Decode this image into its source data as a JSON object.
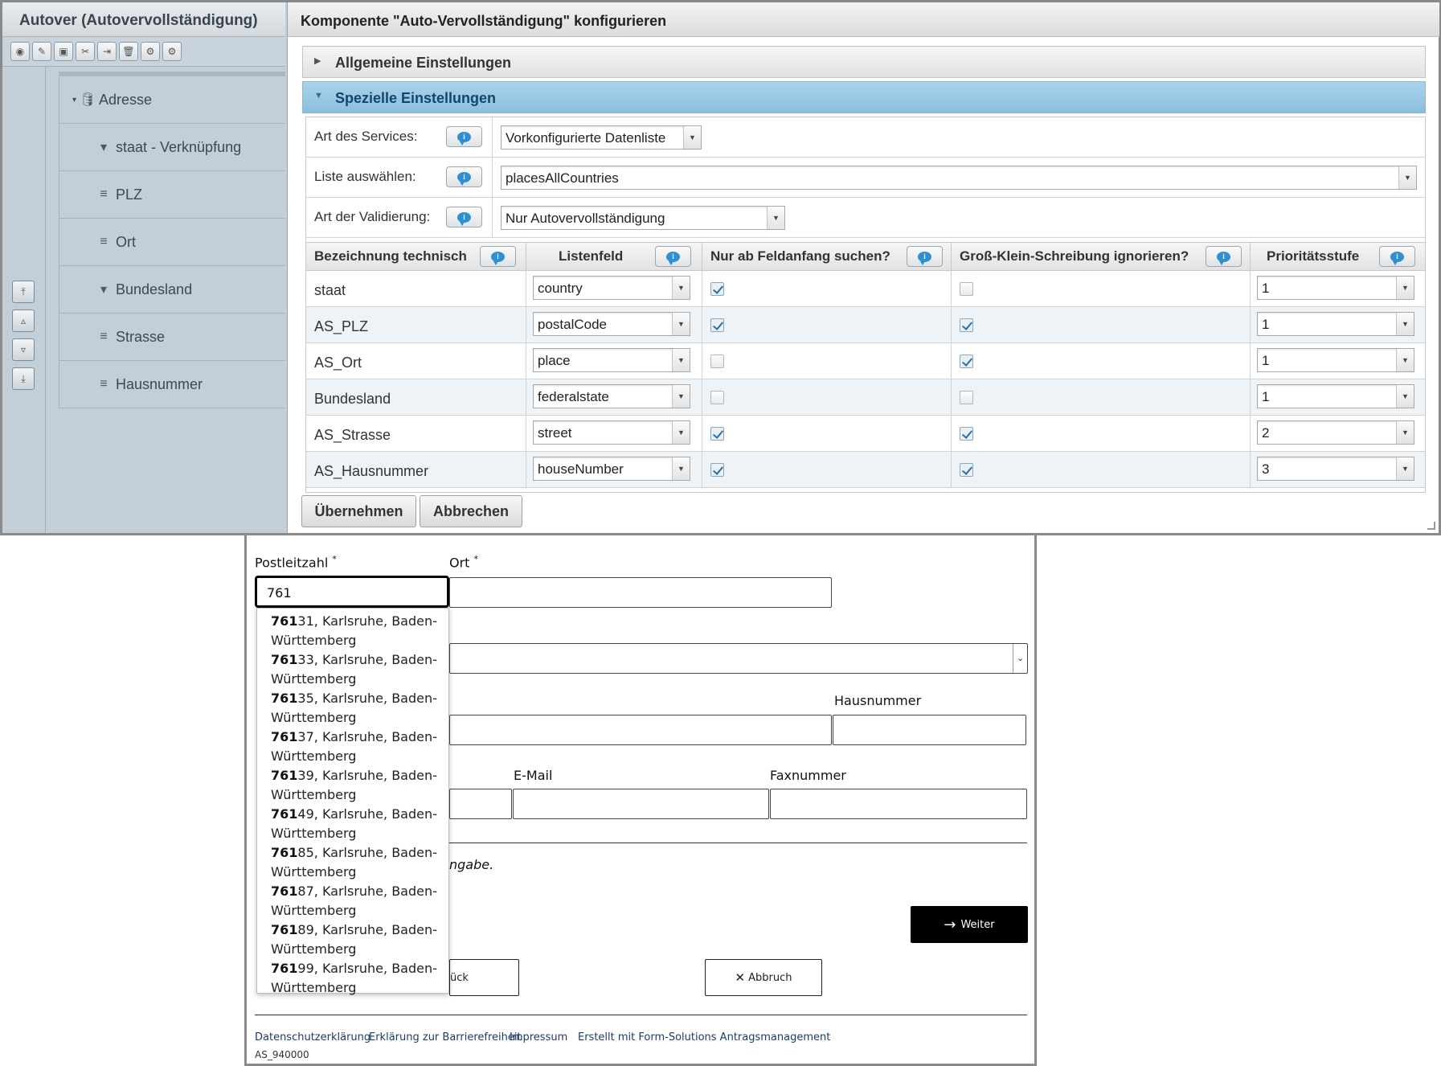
{
  "left_panel": {
    "title": "Autover (Autovervollständigung)",
    "toolbar_icons": [
      "eye-icon",
      "edit-icon",
      "save-icon",
      "pin-icon",
      "export-icon",
      "trash-icon",
      "cogs-icon",
      "gear-icon"
    ],
    "tree": [
      {
        "icon": "database-icon",
        "label": "Adresse",
        "expanded": true
      },
      {
        "icon": "dropdown-field-icon",
        "label": "staat - Verknüpfung"
      },
      {
        "icon": "text-field-icon",
        "label": "PLZ"
      },
      {
        "icon": "text-field-icon",
        "label": "Ort"
      },
      {
        "icon": "dropdown-field-icon",
        "label": "Bundesland"
      },
      {
        "icon": "text-field-icon",
        "label": "Strasse"
      },
      {
        "icon": "text-field-icon",
        "label": "Hausnummer"
      }
    ]
  },
  "dialog": {
    "title": "Komponente \"Auto-Vervollständigung\" konfigurieren",
    "sections": {
      "general": "Allgemeine Einstellungen",
      "special": "Spezielle Einstellungen"
    },
    "service_label": "Art des Services:",
    "service_value": "Vorkonfigurierte Datenliste",
    "list_label": "Liste auswählen:",
    "list_value": "placesAllCountries",
    "validation_label": "Art der Validierung:",
    "validation_value": "Nur Autovervollständigung",
    "columns": {
      "technical": "Bezeichnung technisch",
      "listfield": "Listenfeld",
      "prefix": "Nur ab Feldanfang suchen?",
      "case": "Groß-Klein-Schreibung ignorieren?",
      "priority": "Prioritätsstufe"
    },
    "rows": [
      {
        "name": "staat",
        "field": "country",
        "prefix_only": true,
        "ignore_case": false,
        "priority": "1"
      },
      {
        "name": "AS_PLZ",
        "field": "postalCode",
        "prefix_only": true,
        "ignore_case": true,
        "priority": "1"
      },
      {
        "name": "AS_Ort",
        "field": "place",
        "prefix_only": false,
        "ignore_case": true,
        "priority": "1"
      },
      {
        "name": "Bundesland",
        "field": "federalstate",
        "prefix_only": false,
        "ignore_case": false,
        "priority": "1"
      },
      {
        "name": "AS_Strasse",
        "field": "street",
        "prefix_only": true,
        "ignore_case": true,
        "priority": "2"
      },
      {
        "name": "AS_Hausnummer",
        "field": "houseNumber",
        "prefix_only": true,
        "ignore_case": true,
        "priority": "3"
      }
    ],
    "apply_label": "Übernehmen",
    "cancel_label": "Abbrechen"
  },
  "webform": {
    "plz_label": "Postleitzahl",
    "plz_value": "761",
    "ort_label": "Ort",
    "required_mark": "*",
    "hausnummer_label": "Hausnummer",
    "email_label": "E-Mail",
    "fax_label": "Faxnummer",
    "partial_text": "ngabe.",
    "suggestion_rest": ", Karlsruhe, Baden-Württemberg",
    "suggestions": [
      {
        "match": "761",
        "rest": "31"
      },
      {
        "match": "761",
        "rest": "33"
      },
      {
        "match": "761",
        "rest": "35"
      },
      {
        "match": "761",
        "rest": "37"
      },
      {
        "match": "761",
        "rest": "39"
      },
      {
        "match": "761",
        "rest": "49"
      },
      {
        "match": "761",
        "rest": "85"
      },
      {
        "match": "761",
        "rest": "87"
      },
      {
        "match": "761",
        "rest": "89"
      },
      {
        "match": "761",
        "rest": "99"
      }
    ],
    "weiter_label": "Weiter",
    "back_partial_label": "ück",
    "abbruch_label": "Abbruch",
    "footer_links": [
      "Datenschutzerklärung",
      "Erklärung zur Barrierefreiheit",
      "Impressum",
      "Erstellt mit Form-Solutions Antragsmanagement"
    ],
    "form_id": "AS_940000"
  }
}
